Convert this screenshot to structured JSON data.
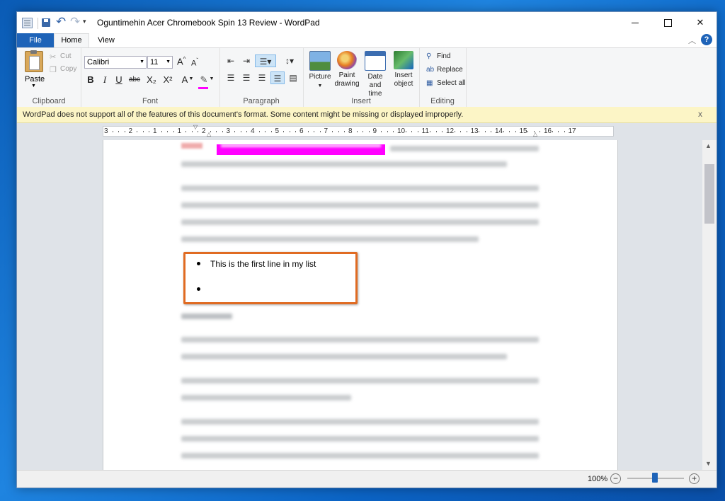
{
  "window": {
    "title": "Oguntimehin Acer Chromebook Spin 13 Review - WordPad",
    "minimize": "",
    "maximize": "",
    "close": "✕"
  },
  "quick_access": {
    "undo": "↶",
    "redo": "↷",
    "dropdown": "▾"
  },
  "tabs": {
    "file": "File",
    "home": "Home",
    "view": "View"
  },
  "ribbon": {
    "clipboard": {
      "label": "Clipboard",
      "paste": "Paste",
      "cut": "Cut",
      "copy": "Copy"
    },
    "font": {
      "label": "Font",
      "family": "Calibri",
      "size": "11",
      "grow": "A",
      "shrink": "A",
      "bold": "B",
      "italic": "I",
      "underline": "U",
      "strike": "abc",
      "subscript": "X₂",
      "superscript": "X²",
      "color": "A",
      "highlight": "✎"
    },
    "paragraph": {
      "label": "Paragraph"
    },
    "insert": {
      "label": "Insert",
      "picture": "Picture",
      "paint_1": "Paint",
      "paint_2": "drawing",
      "date_1": "Date and",
      "date_2": "time",
      "object_1": "Insert",
      "object_2": "object"
    },
    "editing": {
      "label": "Editing",
      "find": "Find",
      "replace": "Replace",
      "select_all": "Select all"
    }
  },
  "infobar": {
    "message": "WordPad does not support all of the features of this document's format. Some content might be missing or displayed improperly.",
    "close": "x"
  },
  "ruler": {
    "labels": [
      "3",
      "2",
      "1",
      "1",
      "2",
      "3",
      "4",
      "5",
      "6",
      "7",
      "8",
      "9",
      "10",
      "11",
      "12",
      "13",
      "14",
      "15",
      "16",
      "17"
    ]
  },
  "document": {
    "list_items": [
      "This is the first line in my list",
      ""
    ]
  },
  "statusbar": {
    "zoom": "100%",
    "zoom_out": "−",
    "zoom_in": "+",
    "zoom_level_percent": 100
  },
  "colors": {
    "file_tab": "#1e63b8",
    "highlight": "#ff00ff",
    "callout": "#e06b22",
    "infobar": "#fcf5c6"
  }
}
